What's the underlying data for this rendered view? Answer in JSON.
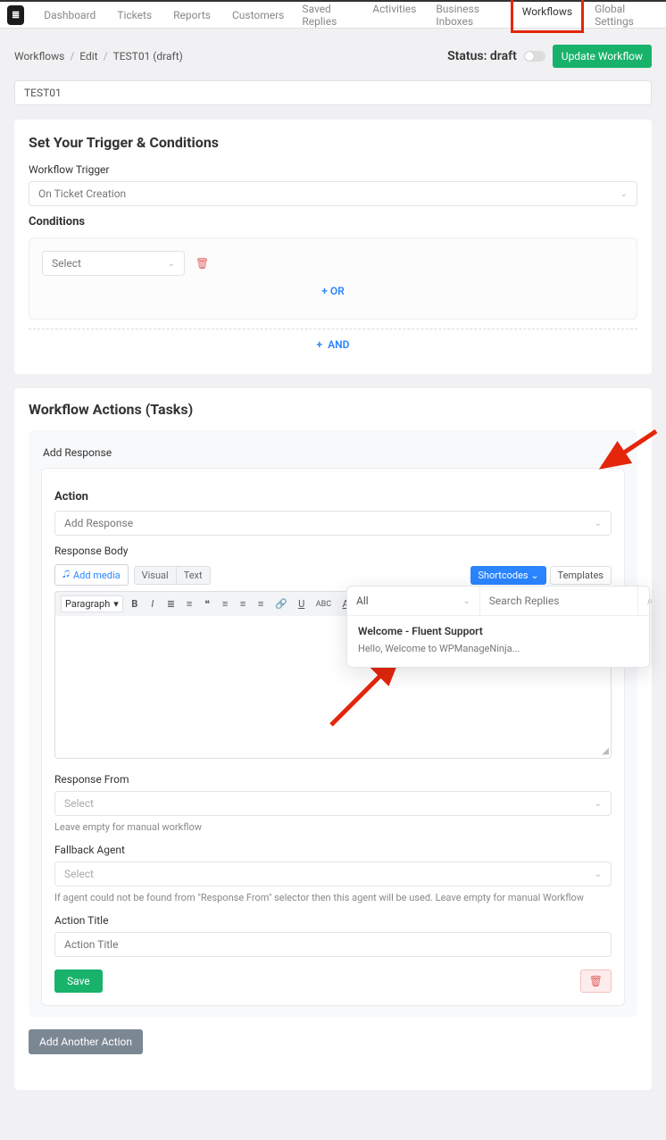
{
  "nav": {
    "left": [
      "Dashboard",
      "Tickets",
      "Reports",
      "Customers"
    ],
    "right": [
      "Saved Replies",
      "Activities",
      "Business Inboxes",
      "Workflows",
      "Global Settings"
    ],
    "activeRight": "Workflows"
  },
  "breadcrumb": {
    "root": "Workflows",
    "edit": "Edit",
    "current": "TEST01 (draft)"
  },
  "status": {
    "label": "Status:",
    "value": "draft",
    "updateBtn": "Update Workflow"
  },
  "titleInput": "TEST01",
  "triggerSection": {
    "heading": "Set Your Trigger & Conditions",
    "triggerLabel": "Workflow Trigger",
    "triggerValue": "On Ticket Creation",
    "conditionsLabel": "Conditions",
    "conditionSelect": "Select",
    "orLabel": "OR",
    "andLabel": "AND",
    "plus": "+"
  },
  "actionsSection": {
    "heading": "Workflow Actions (Tasks)",
    "addResponse": "Add Response",
    "actionLabel": "Action",
    "actionValue": "Add Response",
    "responseBodyLabel": "Response Body",
    "addMedia": "Add media",
    "visualTab": "Visual",
    "textTab": "Text",
    "shortcodesBtn": "Shortcodes",
    "templatesBtn": "Templates",
    "paragraph": "Paragraph",
    "responseFromLabel": "Response From",
    "responseFromHelp": "Leave empty for manual workflow",
    "fallbackLabel": "Fallback Agent",
    "fallbackHelp": "If agent could not be found from \"Response From\" selector then this agent will be used. Leave empty for manual Workflow",
    "actionTitleLabel": "Action Title",
    "actionTitlePlaceholder": "Action Title",
    "selectPlaceholder": "Select",
    "saveBtn": "Save",
    "addAnother": "Add Another Action"
  },
  "popover": {
    "filter": "All",
    "searchPlaceholder": "Search Replies",
    "itemTitle": "Welcome - Fluent Support",
    "itemDesc": "Hello, Welcome to WPManageNinja..."
  },
  "icons": {
    "chev": "⌄",
    "trash": "🗑",
    "media": "🎜",
    "search": "⌕",
    "dropdown": "▾"
  },
  "toolbar": {
    "bold": "B",
    "italic": "I",
    "ul": "≣",
    "ol": "≡",
    "quote": "❝",
    "alignL": "≡",
    "alignC": "≡",
    "alignR": "≡",
    "link": "🔗",
    "underline": "U",
    "abc": "ABC",
    "acolor": "A",
    "more": "…"
  }
}
